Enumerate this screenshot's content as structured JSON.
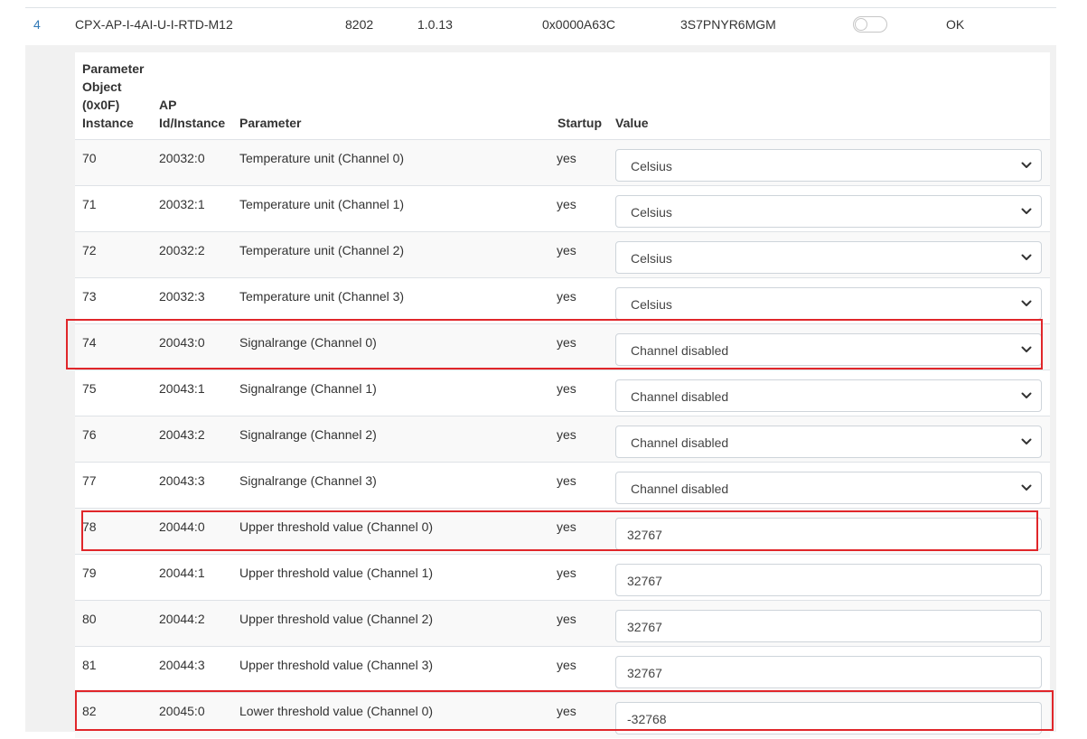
{
  "module": {
    "index": "4",
    "name": "CPX-AP-I-4AI-U-I-RTD-M12",
    "code": "8202",
    "version": "1.0.13",
    "hex_id": "0x0000A63C",
    "serial": "3S7PNYR6MGM",
    "toggle_state": "off",
    "status": "OK"
  },
  "table": {
    "headers": {
      "instance": [
        "Parameter",
        "Object",
        "(0x0F)",
        "Instance"
      ],
      "ap": [
        "AP",
        "Id/Instance"
      ],
      "parameter": "Parameter",
      "startup": "Startup",
      "value": "Value"
    },
    "rows": [
      {
        "instance": "70",
        "ap_id": "20032:0",
        "parameter": "Temperature unit (Channel 0)",
        "startup": "yes",
        "value": "Celsius",
        "control": "select",
        "highlighted": false
      },
      {
        "instance": "71",
        "ap_id": "20032:1",
        "parameter": "Temperature unit (Channel 1)",
        "startup": "yes",
        "value": "Celsius",
        "control": "select",
        "highlighted": false
      },
      {
        "instance": "72",
        "ap_id": "20032:2",
        "parameter": "Temperature unit (Channel 2)",
        "startup": "yes",
        "value": "Celsius",
        "control": "select",
        "highlighted": false
      },
      {
        "instance": "73",
        "ap_id": "20032:3",
        "parameter": "Temperature unit (Channel 3)",
        "startup": "yes",
        "value": "Celsius",
        "control": "select",
        "highlighted": false
      },
      {
        "instance": "74",
        "ap_id": "20043:0",
        "parameter": "Signalrange (Channel 0)",
        "startup": "yes",
        "value": "Channel disabled",
        "control": "select",
        "highlighted": true
      },
      {
        "instance": "75",
        "ap_id": "20043:1",
        "parameter": "Signalrange (Channel 1)",
        "startup": "yes",
        "value": "Channel disabled",
        "control": "select",
        "highlighted": false
      },
      {
        "instance": "76",
        "ap_id": "20043:2",
        "parameter": "Signalrange (Channel 2)",
        "startup": "yes",
        "value": "Channel disabled",
        "control": "select",
        "highlighted": false
      },
      {
        "instance": "77",
        "ap_id": "20043:3",
        "parameter": "Signalrange (Channel 3)",
        "startup": "yes",
        "value": "Channel disabled",
        "control": "select",
        "highlighted": false
      },
      {
        "instance": "78",
        "ap_id": "20044:0",
        "parameter": "Upper threshold value (Channel 0)",
        "startup": "yes",
        "value": "32767",
        "control": "input",
        "highlighted": true
      },
      {
        "instance": "79",
        "ap_id": "20044:1",
        "parameter": "Upper threshold value (Channel 1)",
        "startup": "yes",
        "value": "32767",
        "control": "input",
        "highlighted": false
      },
      {
        "instance": "80",
        "ap_id": "20044:2",
        "parameter": "Upper threshold value (Channel 2)",
        "startup": "yes",
        "value": "32767",
        "control": "input",
        "highlighted": false
      },
      {
        "instance": "81",
        "ap_id": "20044:3",
        "parameter": "Upper threshold value (Channel 3)",
        "startup": "yes",
        "value": "32767",
        "control": "input",
        "highlighted": false
      },
      {
        "instance": "82",
        "ap_id": "20045:0",
        "parameter": "Lower threshold value (Channel 0)",
        "startup": "yes",
        "value": "-32768",
        "control": "input",
        "highlighted": true
      }
    ]
  },
  "colors": {
    "link": "#337ab7",
    "highlight_border": "#e0262a",
    "row_stripe": "#f9f9f9",
    "detail_background": "#f1f1f1"
  },
  "icons": {
    "select_caret": "chevron-down-icon"
  }
}
